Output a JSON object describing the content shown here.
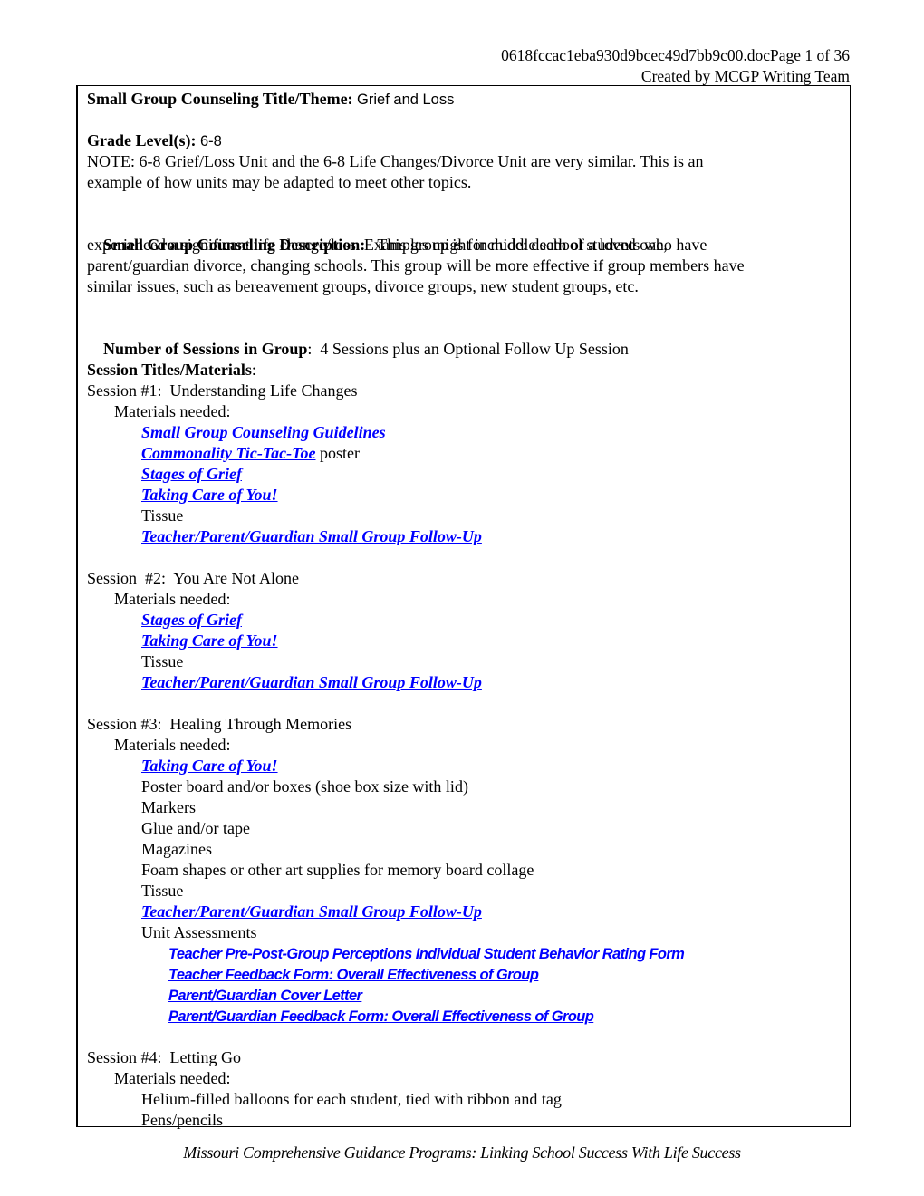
{
  "header": {
    "filename_page": "0618fccac1eba930d9bcec49d7bb9c00.docPage 1 of 36",
    "created_by": "Created by MCGP Writing Team"
  },
  "title": {
    "label": "Small Group Counseling Title/Theme:",
    "value": "Grief and Loss"
  },
  "grade": {
    "label": "Grade Level(s):",
    "value": "6-8",
    "note_line1": "NOTE:  6-8 Grief/Loss Unit and the 6-8 Life Changes/Divorce Unit are very similar.  This is an",
    "note_line2": "example of how units may be adapted to meet other topics."
  },
  "description": {
    "label": "Small Group Counseling Description:",
    "line1": "   This group is for middle school students who have",
    "line2": "experienced a significant life change/loss.  Examples might include:  death of a loved one,",
    "line3": "parent/guardian divorce, changing schools.  This group will be more effective if group members have",
    "line4": "similar issues, such as bereavement groups, divorce groups, new student groups, etc."
  },
  "sessions_count": {
    "label": "Number of Sessions in Group",
    "value": ":  4 Sessions plus an Optional Follow Up Session"
  },
  "session_titles": {
    "label": "Session Titles/Materials",
    "colon": ":"
  },
  "materials_label": "Materials needed:",
  "sessions": [
    {
      "title": "Session #1:  Understanding Life Changes",
      "items": [
        {
          "text": "Small Group Counseling Guidelines",
          "link": true
        },
        {
          "text": "Commonality Tic-Tac-Toe",
          "link": true,
          "suffix": " poster"
        },
        {
          "text": "Stages of Grief",
          "link": true
        },
        {
          "text": "Taking Care of You!",
          "link": true
        },
        {
          "text": "Tissue",
          "link": false
        },
        {
          "text": "Teacher/Parent/Guardian Small Group Follow-Up",
          "link": true
        }
      ]
    },
    {
      "title": "Session  #2:  You Are Not Alone",
      "items": [
        {
          "text": "Stages of Grief",
          "link": true
        },
        {
          "text": "Taking Care of You!",
          "link": true
        },
        {
          "text": "Tissue",
          "link": false
        },
        {
          "text": "Teacher/Parent/Guardian Small Group Follow-Up",
          "link": true
        }
      ]
    },
    {
      "title": "Session #3:  Healing Through Memories",
      "items": [
        {
          "text": "Taking Care of You!",
          "link": true
        },
        {
          "text": "Poster board and/or boxes (shoe box size with lid)",
          "link": false
        },
        {
          "text": "Markers",
          "link": false
        },
        {
          "text": "Glue and/or tape",
          "link": false
        },
        {
          "text": "Magazines",
          "link": false
        },
        {
          "text": "Foam shapes or other art supplies for memory board collage",
          "link": false
        },
        {
          "text": "Tissue",
          "link": false
        },
        {
          "text": "Teacher/Parent/Guardian Small Group Follow-Up",
          "link": true
        },
        {
          "text": "Unit Assessments",
          "link": false
        }
      ],
      "assessments": [
        "Teacher Pre-Post-Group Perceptions Individual Student Behavior Rating Form",
        "Teacher Feedback Form: Overall Effectiveness of Group",
        "Parent/Guardian Cover Letter",
        "Parent/Guardian Feedback Form: Overall Effectiveness of Group"
      ]
    },
    {
      "title": "Session #4:  Letting Go",
      "items": [
        {
          "text": "Helium-filled balloons for each student, tied with ribbon and tag",
          "link": false
        },
        {
          "text": "Pens/pencils",
          "link": false
        }
      ]
    }
  ],
  "footer": "Missouri Comprehensive Guidance Programs: Linking School Success With Life Success",
  "colors": {
    "link": "#0000ff",
    "text": "#000000",
    "border": "#000000"
  }
}
